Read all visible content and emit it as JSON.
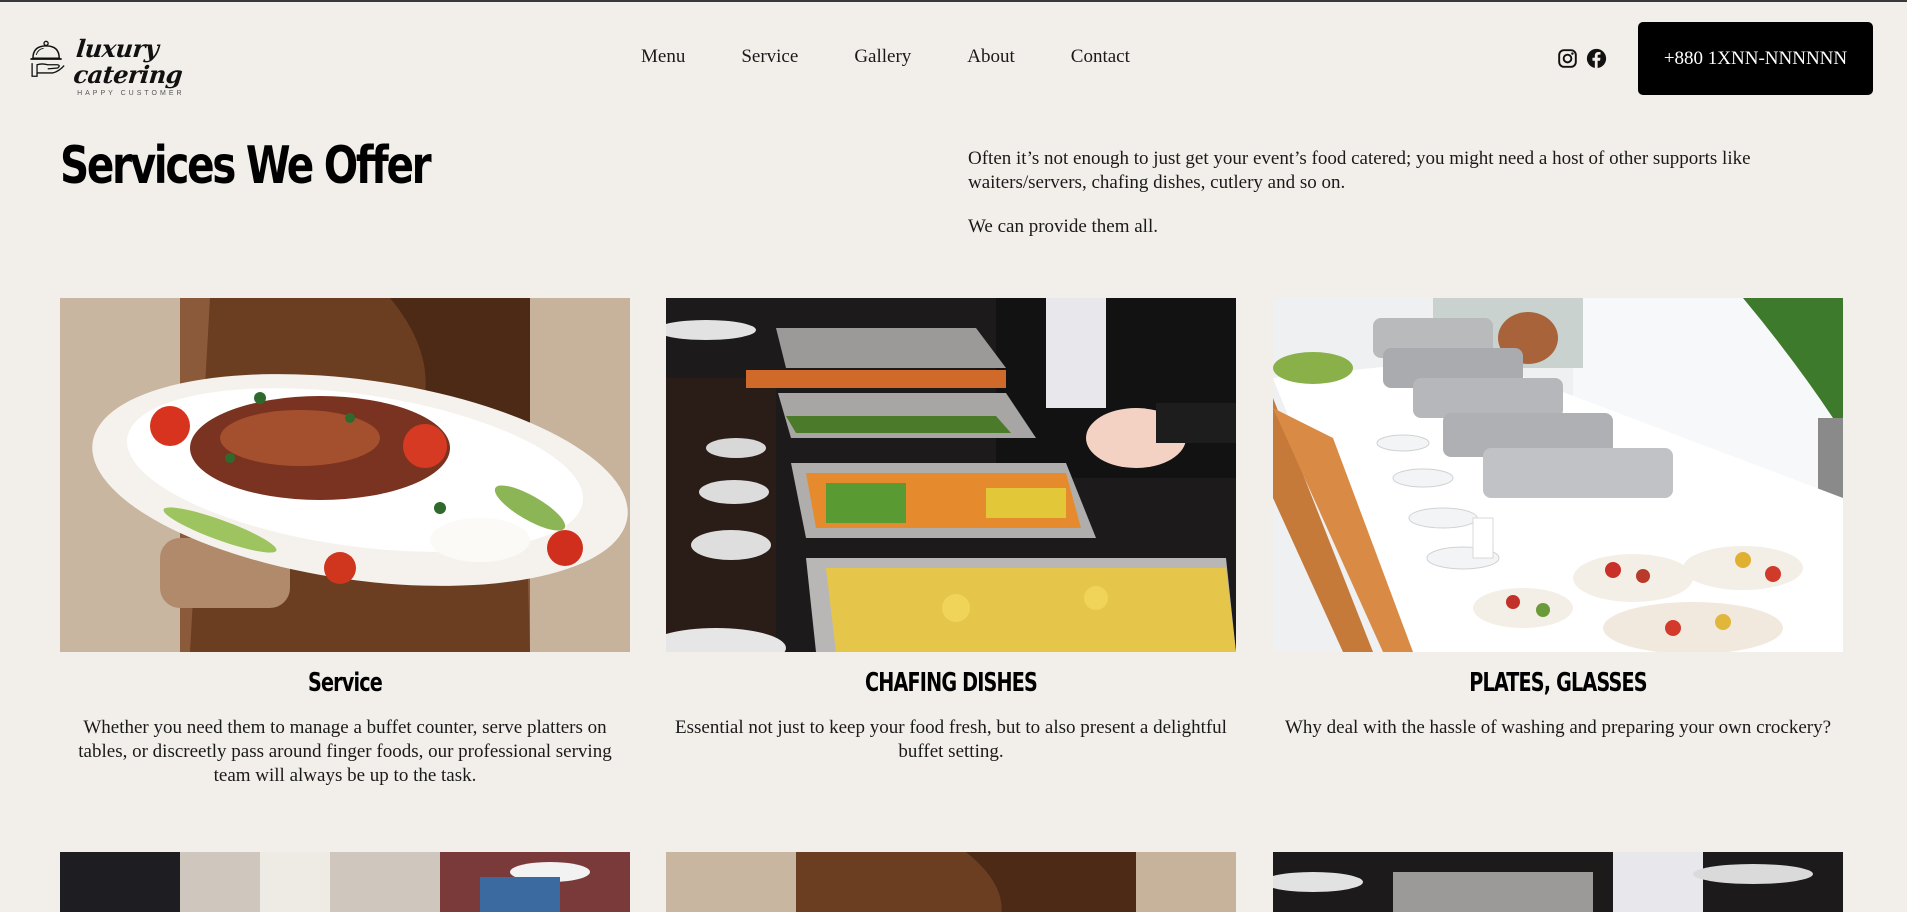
{
  "brand": {
    "name": "luxury catering",
    "tagline": "HAPPY CUSTOMER"
  },
  "nav": {
    "items": [
      {
        "label": "Menu"
      },
      {
        "label": "Service"
      },
      {
        "label": "Gallery"
      },
      {
        "label": "About"
      },
      {
        "label": "Contact"
      }
    ]
  },
  "social": [
    "instagram-icon",
    "facebook-icon"
  ],
  "header": {
    "phone_label": "+880 1XNN-NNNNNN"
  },
  "main": {
    "title": "Services We Offer",
    "intro_paragraph_1": "Often it’s not enough to just get your event’s food catered; you might need a host of other supports like waiters/servers, chafing dishes, cutlery and so on.",
    "intro_paragraph_2": "We can provide them all."
  },
  "cards": [
    {
      "title": "Service",
      "text": "Whether you need them to manage a buffet counter, serve platters on tables, or discreetly pass around finger foods, our professional serving team will always be up to the task.",
      "image": "waiter holding platter"
    },
    {
      "title": "CHAFING DISHES",
      "text": "Essential not just to keep your food fresh, but to also present a delightful buffet setting.",
      "image": "buffet chafing dishes"
    },
    {
      "title": "PLATES, GLASSES",
      "text": "Why deal with the hassle of washing and preparing your own crockery?",
      "image": "buffet table with plates"
    }
  ],
  "colors": {
    "background": "#f2eeea",
    "button": "#000000",
    "button_text": "#ffffff"
  }
}
